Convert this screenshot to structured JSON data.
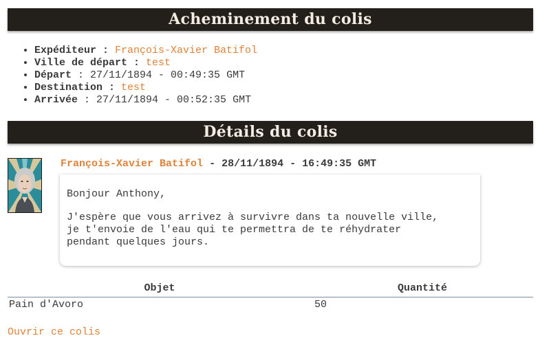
{
  "routing": {
    "title": "Acheminement du colis",
    "items": [
      {
        "label": "Expéditeur",
        "value": "François-Xavier Batifol",
        "highlight": true
      },
      {
        "label": "Ville de départ",
        "value": "test",
        "highlight": true
      },
      {
        "label": "Départ",
        "value": "27/11/1894 - 00:49:35 GMT",
        "highlight": false
      },
      {
        "label": "Destination",
        "value": "test",
        "highlight": true
      },
      {
        "label": "Arrivée",
        "value": "27/11/1894 - 00:52:35 GMT",
        "highlight": false
      }
    ]
  },
  "details": {
    "title": "Détails du colis",
    "message": {
      "author": "François-Xavier Batifol",
      "date": "28/11/1894 - 16:49:35 GMT",
      "greeting": "Bonjour Anthony,",
      "body": "J'espère que vous arrivez à survivre dans ta nouvelle ville,\nje t'envoie de l'eau qui te permettra de te réhydrater\npendant quelques jours."
    }
  },
  "table": {
    "headers": [
      "Objet",
      "Quantité"
    ],
    "rows": [
      {
        "object": "Pain d'Avoro",
        "quantity": "50"
      }
    ]
  },
  "actions": {
    "open_label": "Ouvrir ce colis"
  },
  "colors": {
    "header_bar": "#231f1b",
    "header_text": "#f3ece2",
    "accent": "#e0823a"
  }
}
